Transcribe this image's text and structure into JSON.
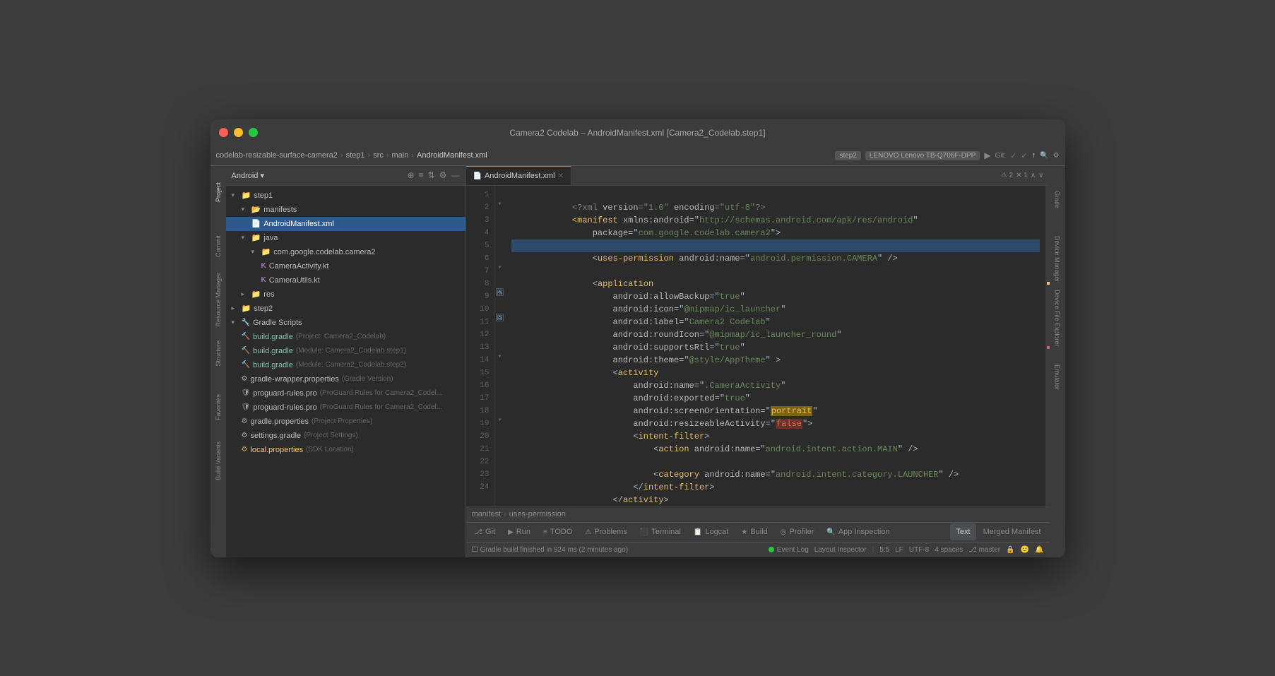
{
  "window": {
    "title": "Camera2 Codelab – AndroidManifest.xml [Camera2_Codelab.step1]",
    "traffic_lights": [
      "red",
      "yellow",
      "green"
    ]
  },
  "breadcrumb": {
    "items": [
      "codelab-resizable-surface-camera2",
      "step1",
      "src",
      "main",
      "AndroidManifest.xml"
    ]
  },
  "toolbar": {
    "branch": "step2",
    "device": "LENOVO Lenovo TB-Q706F-DPP"
  },
  "project_panel": {
    "title": "Android",
    "header_icons": [
      "⊕",
      "≡",
      "⇅",
      "⚙",
      "—"
    ],
    "tree": [
      {
        "indent": 0,
        "type": "folder",
        "label": "step1",
        "expanded": true
      },
      {
        "indent": 1,
        "type": "folder",
        "label": "manifests",
        "expanded": true
      },
      {
        "indent": 2,
        "type": "xml",
        "label": "AndroidManifest.xml",
        "selected": true
      },
      {
        "indent": 1,
        "type": "folder",
        "label": "java",
        "expanded": true
      },
      {
        "indent": 2,
        "type": "folder",
        "label": "com.google.codelab.camera2",
        "expanded": true
      },
      {
        "indent": 3,
        "type": "kt",
        "label": "CameraActivity.kt"
      },
      {
        "indent": 3,
        "type": "kt",
        "label": "CameraUtils.kt"
      },
      {
        "indent": 1,
        "type": "folder",
        "label": "res",
        "collapsed": true
      },
      {
        "indent": 0,
        "type": "folder",
        "label": "step2",
        "collapsed": true
      },
      {
        "indent": 0,
        "type": "folder",
        "label": "Gradle Scripts",
        "expanded": true
      },
      {
        "indent": 1,
        "type": "gradle",
        "label": "build.gradle",
        "subtitle": "(Project: Camera2_Codelab)"
      },
      {
        "indent": 1,
        "type": "gradle",
        "label": "build.gradle",
        "subtitle": "(Module: Camera2_Codelab.step1)"
      },
      {
        "indent": 1,
        "type": "gradle",
        "label": "build.gradle",
        "subtitle": "(Module: Camera2_Codelab.step2)"
      },
      {
        "indent": 1,
        "type": "prop",
        "label": "gradle-wrapper.properties",
        "subtitle": "(Gradle Version)"
      },
      {
        "indent": 1,
        "type": "prop",
        "label": "proguard-rules.pro",
        "subtitle": "(ProGuard Rules for Camera2_Codel..."
      },
      {
        "indent": 1,
        "type": "prop",
        "label": "proguard-rules.pro",
        "subtitle": "(ProGuard Rules for Camera2_Codel..."
      },
      {
        "indent": 1,
        "type": "prop",
        "label": "gradle.properties",
        "subtitle": "(Project Properties)"
      },
      {
        "indent": 1,
        "type": "prop",
        "label": "settings.gradle",
        "subtitle": "(Project Settings)"
      },
      {
        "indent": 1,
        "type": "prop",
        "label": "local.properties",
        "subtitle": "(SDK Location)",
        "special": "orange"
      }
    ]
  },
  "editor": {
    "tabs": [
      {
        "label": "AndroidManifest.xml",
        "active": true
      }
    ],
    "lines": [
      {
        "num": 1,
        "content": "<?xml version=\"1.0\" encoding=\"utf-8\"?>",
        "type": "decl"
      },
      {
        "num": 2,
        "content": "<manifest xmlns:android=\"http://schemas.android.com/apk/res/android\"",
        "type": "tag"
      },
      {
        "num": 3,
        "content": "    package=\"com.google.codelab.camera2\">",
        "type": "tag"
      },
      {
        "num": 4,
        "content": "",
        "type": "blank"
      },
      {
        "num": 5,
        "content": "    <uses-permission android:name=\"android.permission.CAMERA\" />",
        "type": "tag",
        "highlighted": true
      },
      {
        "num": 6,
        "content": "",
        "type": "blank"
      },
      {
        "num": 7,
        "content": "    <application",
        "type": "tag"
      },
      {
        "num": 8,
        "content": "        android:allowBackup=\"true\"",
        "type": "attr"
      },
      {
        "num": 9,
        "content": "        android:icon=\"@mipmap/ic_launcher\"",
        "type": "attr"
      },
      {
        "num": 10,
        "content": "        android:label=\"Camera2 Codelab\"",
        "type": "attr"
      },
      {
        "num": 11,
        "content": "        android:roundIcon=\"@mipmap/ic_launcher_round\"",
        "type": "attr"
      },
      {
        "num": 12,
        "content": "        android:supportsRtl=\"true\"",
        "type": "attr"
      },
      {
        "num": 13,
        "content": "        android:theme=\"@style/AppTheme\" >",
        "type": "attr"
      },
      {
        "num": 14,
        "content": "        <activity",
        "type": "tag"
      },
      {
        "num": 15,
        "content": "            android:name=\".CameraActivity\"",
        "type": "attr"
      },
      {
        "num": 16,
        "content": "            android:exported=\"true\"",
        "type": "attr"
      },
      {
        "num": 17,
        "content": "            android:screenOrientation=\"portrait\"",
        "type": "attr",
        "highlight_val": "portrait"
      },
      {
        "num": 18,
        "content": "            android:resizeableActivity=\"false\">",
        "type": "attr",
        "highlight_val": "false"
      },
      {
        "num": 19,
        "content": "            <intent-filter>",
        "type": "tag"
      },
      {
        "num": 20,
        "content": "                <action android:name=\"android.intent.action.MAIN\" />",
        "type": "tag"
      },
      {
        "num": 21,
        "content": "",
        "type": "blank"
      },
      {
        "num": 22,
        "content": "                <category android:name=\"android.intent.category.LAUNCHER\" />",
        "type": "tag"
      },
      {
        "num": 23,
        "content": "            </intent-filter>",
        "type": "tag"
      },
      {
        "num": 24,
        "content": "        </activity>",
        "type": "tag"
      }
    ],
    "breadcrumb": [
      "manifest",
      "uses-permission"
    ]
  },
  "bottom_tabs": {
    "tabs": [
      {
        "icon": "⎇",
        "label": "Git",
        "active": false
      },
      {
        "icon": "▶",
        "label": "Run",
        "active": false
      },
      {
        "icon": "≡",
        "label": "TODO",
        "active": false
      },
      {
        "icon": "⚠",
        "label": "Problems",
        "active": false
      },
      {
        "icon": "⬛",
        "label": "Terminal",
        "active": false
      },
      {
        "icon": "📋",
        "label": "Logcat",
        "active": false
      },
      {
        "icon": "★",
        "label": "Build",
        "active": false
      },
      {
        "icon": "◎",
        "label": "Profiler",
        "active": false
      },
      {
        "icon": "🔍",
        "label": "App Inspection",
        "active": false
      }
    ],
    "text_tab": {
      "label": "Text",
      "active": true
    },
    "merged_tab": {
      "label": "Merged Manifest",
      "active": false
    }
  },
  "right_tabs": {
    "tabs": [
      {
        "label": "Grade"
      },
      {
        "label": "Device Manager"
      },
      {
        "label": "Device File Explorer"
      },
      {
        "label": "Emulator"
      }
    ]
  },
  "status_bar": {
    "git_icon": "⎇",
    "git_label": "Git",
    "run_icon": "▶",
    "run_label": "Run",
    "todo_label": "TODO",
    "problems_icon": "⚠",
    "problems_label": "Problems",
    "terminal_label": "Terminal",
    "logcat_label": "Logcat",
    "build_label": "Build",
    "profiler_label": "Profiler",
    "app_inspection_label": "App Inspection",
    "message": "Gradle build finished in 924 ms (2 minutes ago)",
    "position": "5:5",
    "encoding": "LF",
    "charset": "UTF-8",
    "indent": "4 spaces",
    "branch": "master",
    "event_log": "Event Log",
    "layout_inspector": "Layout Inspector"
  }
}
